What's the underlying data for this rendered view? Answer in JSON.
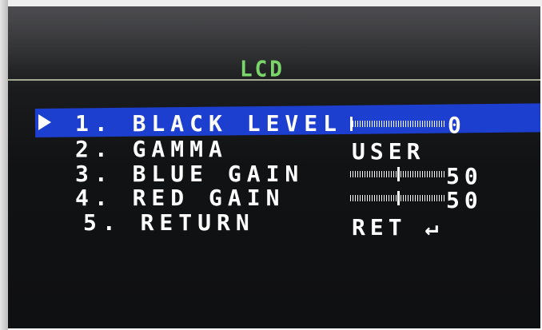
{
  "menu": {
    "title": "LCD",
    "selected_index": 0,
    "items": [
      {
        "label": "1. BLACK LEVEL",
        "type": "slider",
        "value": "0",
        "level": 0.0
      },
      {
        "label": "2. GAMMA",
        "type": "text",
        "value": "USER"
      },
      {
        "label": "3. BLUE GAIN",
        "type": "slider",
        "value": "50",
        "level": 0.5
      },
      {
        "label": "4. RED GAIN",
        "type": "slider",
        "value": "50",
        "level": 0.5
      },
      {
        "label": "5. RETURN",
        "type": "text",
        "value": "RET ↵"
      }
    ]
  },
  "colors": {
    "title": "#7bd66a",
    "highlight": "#1d3fd0",
    "text": "#ffffff",
    "background": "#111214"
  },
  "icons": {
    "pointer": "selection-pointer-icon",
    "return": "return-arrow-icon"
  }
}
